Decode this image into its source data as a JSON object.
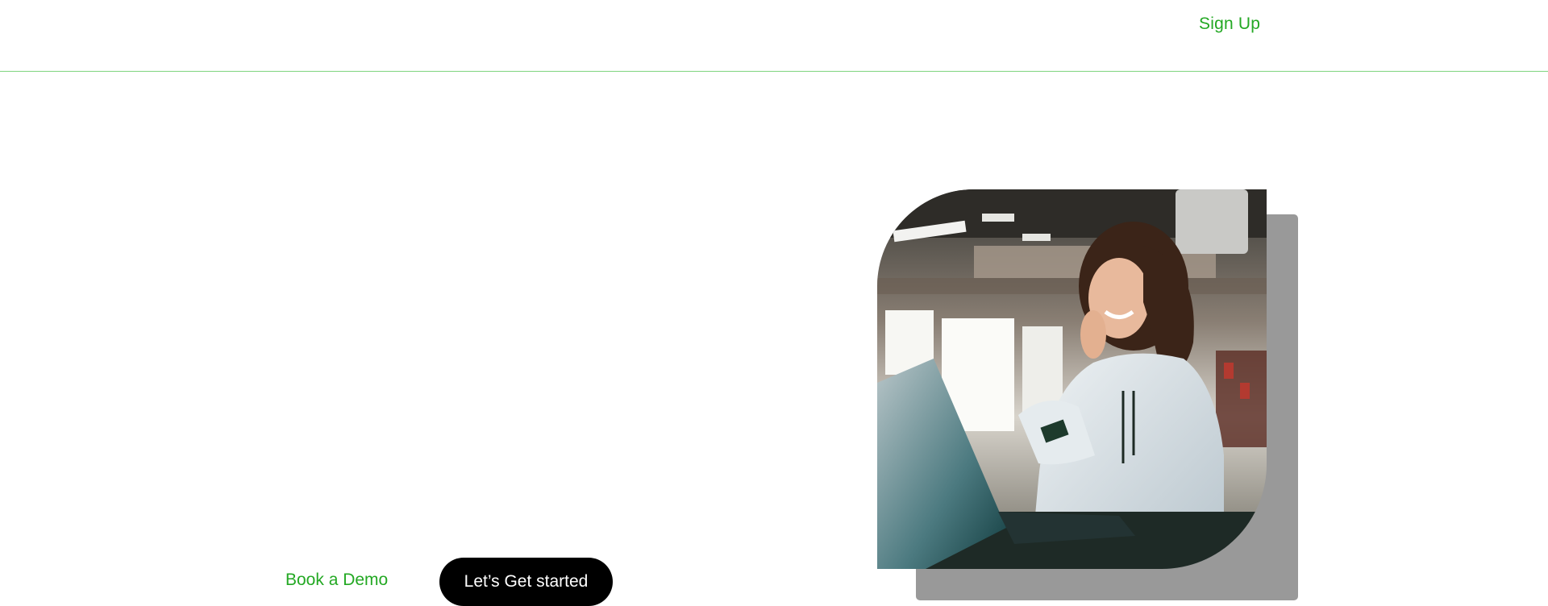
{
  "header": {
    "signup_label": "Sign Up"
  },
  "hero": {
    "image_icon": "person-with-laptop-photo",
    "book_demo_label": "Book a Demo",
    "cta_label": "Let’s Get started"
  },
  "colors": {
    "accent_green": "#23a823",
    "divider_green": "#7fd47f",
    "cta_background": "#000000",
    "shadow_card": "#999999"
  }
}
